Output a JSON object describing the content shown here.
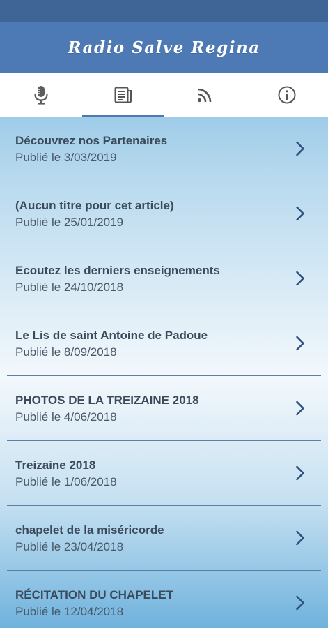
{
  "app": {
    "title": "Radio Salve Regina"
  },
  "tabs": [
    {
      "icon": "microphone-icon",
      "active": false
    },
    {
      "icon": "news-icon",
      "active": true
    },
    {
      "icon": "rss-icon",
      "active": false
    },
    {
      "icon": "info-icon",
      "active": false
    }
  ],
  "articles": [
    {
      "title": "Découvrez nos Partenaires",
      "date": "Publié le 3/03/2019"
    },
    {
      "title": "(Aucun titre pour cet article)",
      "date": "Publié le 25/01/2019"
    },
    {
      "title": "Ecoutez les derniers enseignements",
      "date": "Publié le 24/10/2018"
    },
    {
      "title": "Le Lis de saint Antoine de Padoue",
      "date": "Publié le 8/09/2018"
    },
    {
      "title": "PHOTOS DE LA TREIZAINE 2018",
      "date": "Publié le 4/06/2018"
    },
    {
      "title": "Treizaine 2018",
      "date": "Publié le 1/06/2018"
    },
    {
      "title": "chapelet de la miséricorde",
      "date": "Publié le 23/04/2018"
    },
    {
      "title": "RÉCITATION DU CHAPELET",
      "date": "Publié le 12/04/2018"
    }
  ],
  "colors": {
    "status_bar": "#3f6496",
    "app_bar": "#4d7ab4",
    "accent": "#4d7ab4",
    "chevron": "#2f4f7f"
  }
}
